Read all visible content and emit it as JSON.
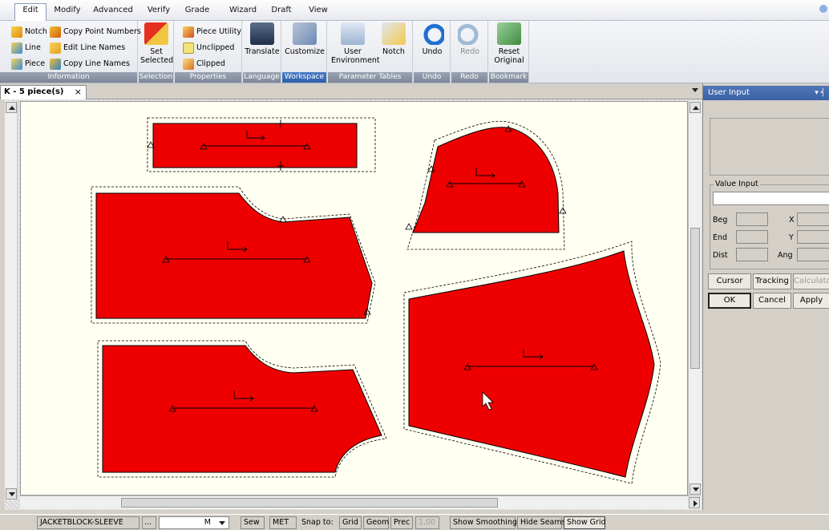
{
  "menu": {
    "tabs": [
      "Edit",
      "Modify",
      "Advanced",
      "Verify",
      "Grade",
      "Wizard",
      "Draft",
      "View"
    ],
    "active": "Edit"
  },
  "ribbon": {
    "information": {
      "label": "Information",
      "buttons": [
        "Notch",
        "Copy Point Numbers",
        "Line",
        "Edit Line Names",
        "Piece",
        "Copy Line Names"
      ]
    },
    "selection": {
      "label": "Selection",
      "button": "Set Selected"
    },
    "properties": {
      "label": "Properties",
      "buttons": [
        "Piece Utility",
        "Unclipped",
        "Clipped"
      ]
    },
    "language": {
      "label": "Language",
      "button": "Translate"
    },
    "workspace": {
      "label": "Workspace",
      "button": "Customize"
    },
    "parameter_tables": {
      "label": "Parameter Tables",
      "buttons": [
        "User Environment",
        "Notch"
      ]
    },
    "undo": {
      "label": "Undo",
      "button": "Undo"
    },
    "redo": {
      "label": "Redo",
      "button": "Redo"
    },
    "bookmark": {
      "label": "Bookmark",
      "button": "Reset Original"
    }
  },
  "document": {
    "tab_title": "K - 5 piece(s)",
    "close_glyph": "×"
  },
  "pieces": {
    "count": 5,
    "fill_color": "#ee0000",
    "outline_color": "#000000"
  },
  "panel": {
    "title": "User Input",
    "title_controls": "▾ ╡",
    "value_input_label": "Value Input",
    "fields": {
      "beg": "Beg",
      "end": "End",
      "dist": "Dist",
      "x": "X",
      "y": "Y",
      "ang": "Ang"
    },
    "buttons": {
      "cursor": "Cursor",
      "tracking": "Tracking",
      "calculator": "Calculato",
      "ok": "OK",
      "cancel": "Cancel",
      "apply": "Apply"
    }
  },
  "statusbar": {
    "piece_name": "JACKETBLOCK-SLEEVE",
    "ellipsis": "...",
    "size": "M",
    "sew": "Sew",
    "units": "MET",
    "snap_to_label": "Snap to:",
    "grid": "Grid",
    "geom": "Geom",
    "prec": "Prec",
    "prec_value": "1,00",
    "show_smoothing": "Show Smoothing",
    "hide_seams": "Hide Seams",
    "show_grid": "Show Grid"
  }
}
